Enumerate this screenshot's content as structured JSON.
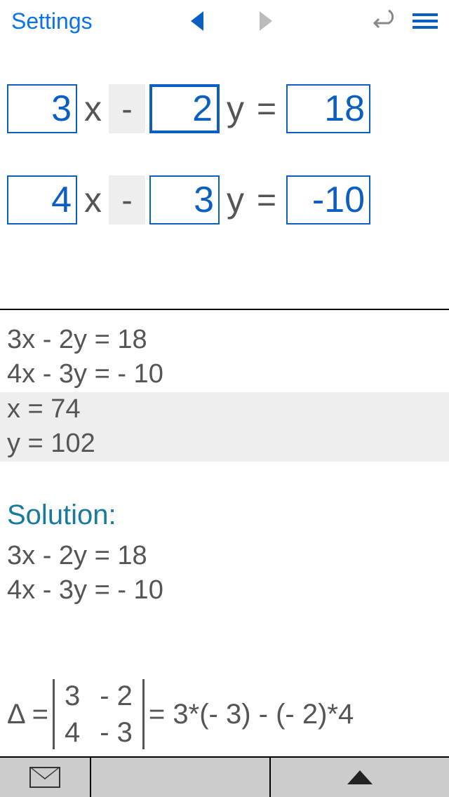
{
  "header": {
    "settings": "Settings"
  },
  "equations": [
    {
      "a": "3",
      "sign": "-",
      "b": "2",
      "varX": "x",
      "varY": "y",
      "eq": "=",
      "c": "18",
      "selected": 1
    },
    {
      "a": "4",
      "sign": "-",
      "b": "3",
      "varX": "x",
      "varY": "y",
      "eq": "=",
      "c": "-10",
      "selected": -1
    }
  ],
  "results": {
    "eq1": "3x - 2y = 18",
    "eq2": "4x - 3y = - 10",
    "xsol": "x = 74",
    "ysol": "y = 102",
    "solutionHeading": "Solution:",
    "sol_eq1": "3x - 2y = 18",
    "sol_eq2": "4x - 3y = - 10"
  },
  "determinant": {
    "delta": "Δ =",
    "m00": "3",
    "m01": "- 2",
    "m10": "4",
    "m11": "- 3",
    "expansion": "= 3*(- 3) - (- 2)*4"
  }
}
